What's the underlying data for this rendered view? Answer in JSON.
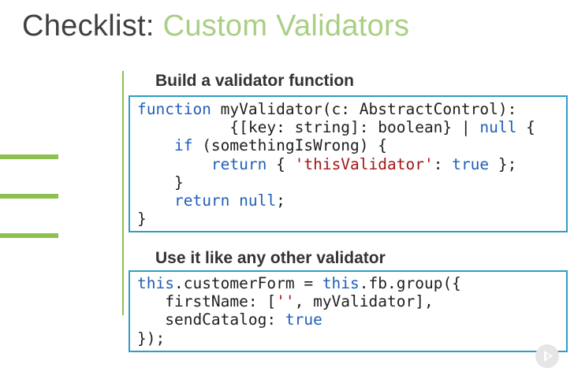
{
  "slide": {
    "title_prefix": "Checklist: ",
    "title_highlight": "Custom Validators"
  },
  "section1": {
    "heading": "Build a validator function",
    "code_lines": [
      [
        {
          "t": "function",
          "c": "kw"
        },
        {
          "t": " myValidator(c: AbstractControl):"
        }
      ],
      [
        {
          "t": "          {[key: string]: boolean} | "
        },
        {
          "t": "null",
          "c": "kw"
        },
        {
          "t": " {"
        }
      ],
      [
        {
          "t": "    "
        },
        {
          "t": "if",
          "c": "kw"
        },
        {
          "t": " (somethingIsWrong) {"
        }
      ],
      [
        {
          "t": "        "
        },
        {
          "t": "return",
          "c": "kw"
        },
        {
          "t": " { "
        },
        {
          "t": "'thisValidator'",
          "c": "str"
        },
        {
          "t": ": "
        },
        {
          "t": "true",
          "c": "kw"
        },
        {
          "t": " };"
        }
      ],
      [
        {
          "t": "    }"
        }
      ],
      [
        {
          "t": "    "
        },
        {
          "t": "return",
          "c": "kw"
        },
        {
          "t": " "
        },
        {
          "t": "null",
          "c": "kw"
        },
        {
          "t": ";"
        }
      ],
      [
        {
          "t": "}"
        }
      ]
    ]
  },
  "section2": {
    "heading": "Use it like any other validator",
    "code_lines": [
      [
        {
          "t": "this",
          "c": "kw"
        },
        {
          "t": ".customerForm = "
        },
        {
          "t": "this",
          "c": "kw"
        },
        {
          "t": ".fb.group({"
        }
      ],
      [
        {
          "t": "   firstName: ["
        },
        {
          "t": "''",
          "c": "str"
        },
        {
          "t": ", myValidator],"
        }
      ],
      [
        {
          "t": "   sendCatalog: "
        },
        {
          "t": "true",
          "c": "kw"
        }
      ],
      [
        {
          "t": "});"
        }
      ]
    ]
  },
  "colors": {
    "accent_green": "#8cc152",
    "title_highlight": "#a9cf84",
    "code_border": "#2e9ec4",
    "keyword": "#1f5fb8",
    "string": "#a31515"
  },
  "icons": {
    "play": "play-icon"
  }
}
